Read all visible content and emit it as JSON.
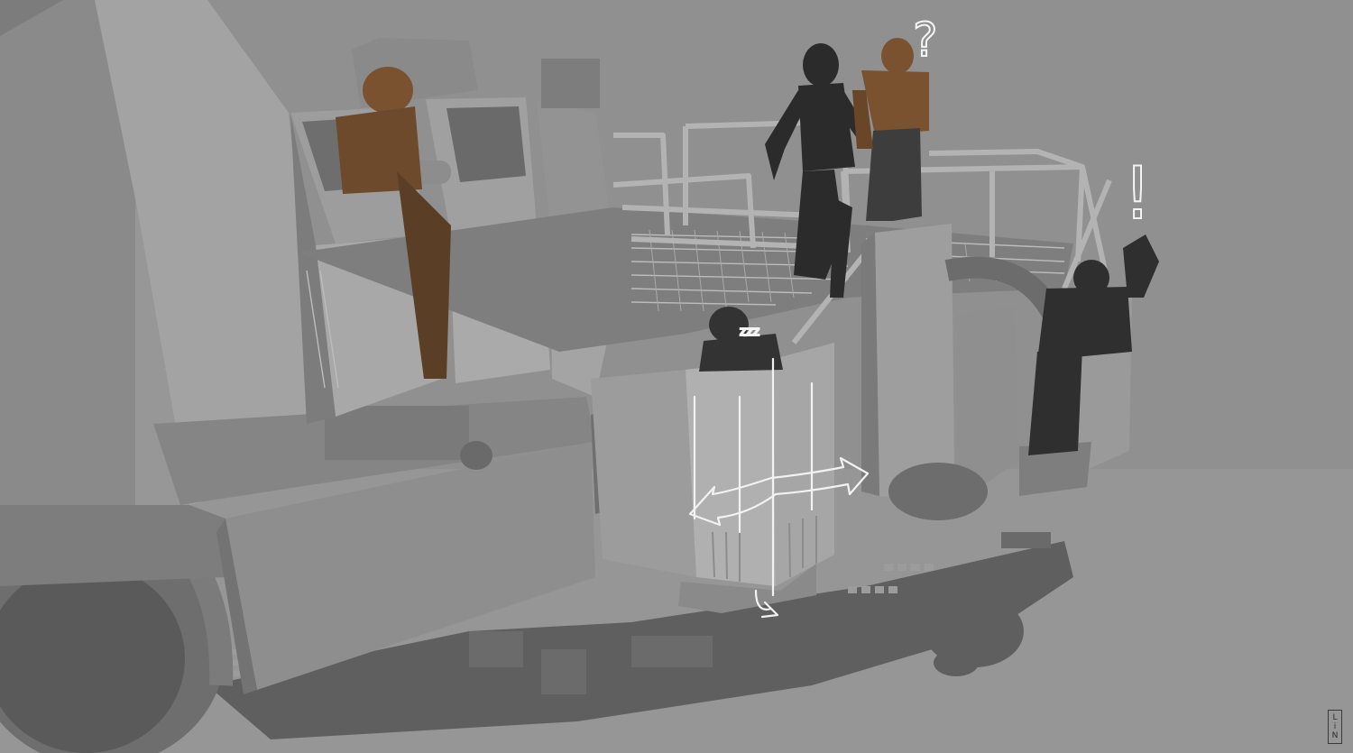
{
  "scene": {
    "subject": "armored-vehicle-side-view",
    "palette": {
      "background": "#8e8e8e",
      "floor": "#9a9a9a",
      "shadow": "#5e5e5e",
      "hull_light": "#a6a6a6",
      "hull_mid": "#8a8a8a",
      "hull_dark": "#6b6b6b",
      "grate": "#b5b5b5",
      "figure_dark": "#2a2a2a",
      "figure_camo": "#7a5230",
      "sketch": "#f2f2f2"
    }
  },
  "annotations": {
    "question_mark": "?",
    "exclamation_mark": "!",
    "sleep_mark": "zzz"
  },
  "signature": {
    "letters": [
      "L",
      "i",
      "N"
    ]
  }
}
